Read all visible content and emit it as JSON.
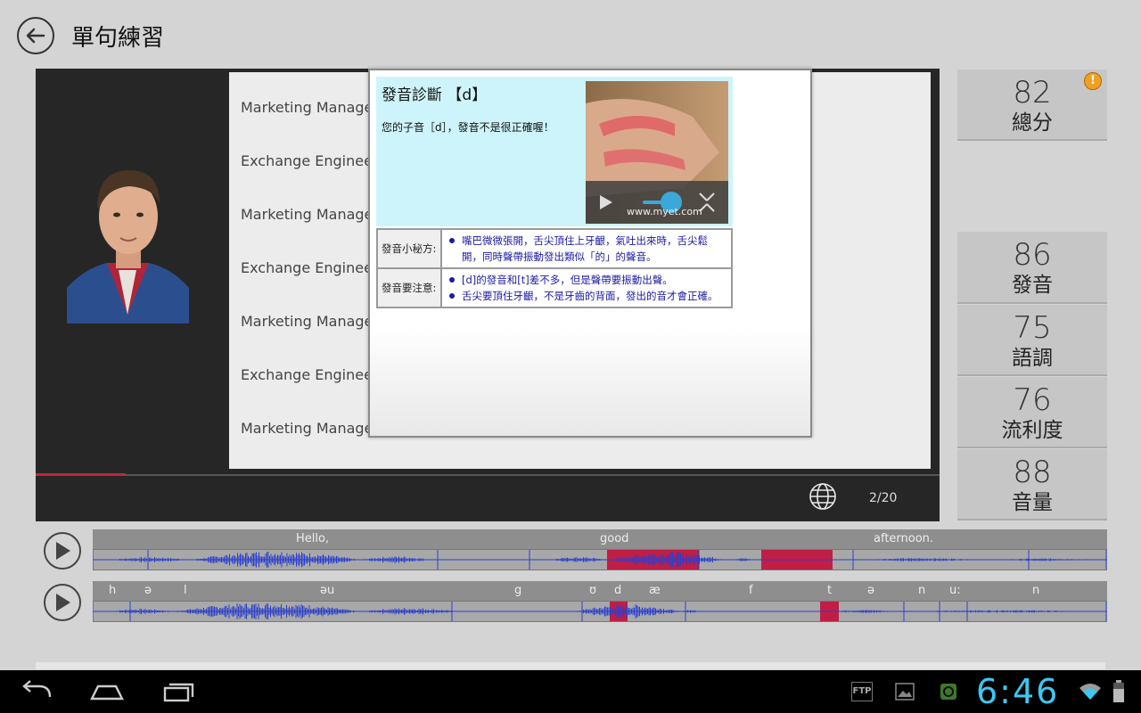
{
  "header": {
    "title": "單句練習"
  },
  "sentences": [
    "Marketing Manager",
    "Exchange Engineer",
    "Marketing Manager",
    "Exchange Engineer",
    "Marketing Manager",
    "Exchange Engineer",
    "Marketing Manager"
  ],
  "player": {
    "page": "2/20",
    "progress": 0.1
  },
  "popup": {
    "title": "發音診斷 【d】",
    "description": "您的子音［d］，發音不是很正確喔！",
    "video_watermark": "www.myet.com",
    "tips_label": "發音小秘方:",
    "tips": [
      "嘴巴微微張開，舌尖頂住上牙齦，氣吐出來時，舌尖鬆開，同時聲帶振動發出類似「的」的聲音。"
    ],
    "notes_label": "發音要注意:",
    "notes": [
      "[d]的發音和[t]差不多，但是聲帶要振動出聲。",
      "舌尖要頂住牙齦，不是牙齒的背面，發出的音才會正確。"
    ]
  },
  "scores": {
    "total": {
      "value": "82",
      "label": "總分",
      "warning": "!"
    },
    "pronunciation": {
      "value": "86",
      "label": "發音"
    },
    "intonation": {
      "value": "75",
      "label": "語調"
    },
    "fluency": {
      "value": "76",
      "label": "流利度"
    },
    "volume": {
      "value": "88",
      "label": "音量"
    }
  },
  "words": [
    "Hello,",
    "good",
    "afternoon."
  ],
  "phonemes": [
    "h",
    "ə",
    "l",
    "əu",
    "g",
    "ʊ",
    "d",
    "æ",
    "f",
    "t",
    "ə",
    "n",
    "u:",
    "n"
  ],
  "statusbar": {
    "clock": "6:46",
    "ftp": "FTP"
  },
  "colors": {
    "accent": "#c0263a",
    "clock": "#3cc8f2",
    "waveform": "#2a3fd0",
    "error_highlight": "#c01e45"
  }
}
